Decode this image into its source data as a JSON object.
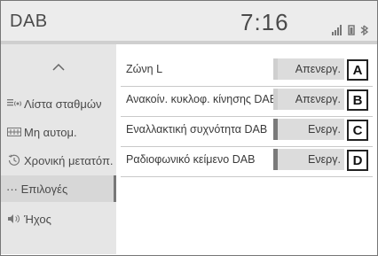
{
  "header": {
    "title": "DAB",
    "clock": "7:16"
  },
  "sidebar": {
    "items": [
      {
        "label": "Λίστα σταθμών",
        "icon": "station-list-icon"
      },
      {
        "label": "Μη αυτομ.",
        "icon": "manual-tuning-icon"
      },
      {
        "label": "Χρονική μετατόπ.",
        "icon": "time-shift-icon"
      },
      {
        "label": "··· Επιλογές",
        "icon": ""
      },
      {
        "label": "Ήχος",
        "icon": "speaker-icon"
      }
    ]
  },
  "settings": [
    {
      "label": "Ζώνη L",
      "state": "Απενεργ.",
      "on": false,
      "badge": "A"
    },
    {
      "label": "Ανακοίν. κυκλοφ. κίνησης DAB",
      "state": "Απενεργ.",
      "on": false,
      "badge": "B"
    },
    {
      "label": "Εναλλακτική συχνότητα DAB",
      "state": "Ενεργ.",
      "on": true,
      "badge": "C"
    },
    {
      "label": "Ραδιοφωνικό κείμενο DAB",
      "state": "Ενεργ.",
      "on": true,
      "badge": "D"
    }
  ]
}
